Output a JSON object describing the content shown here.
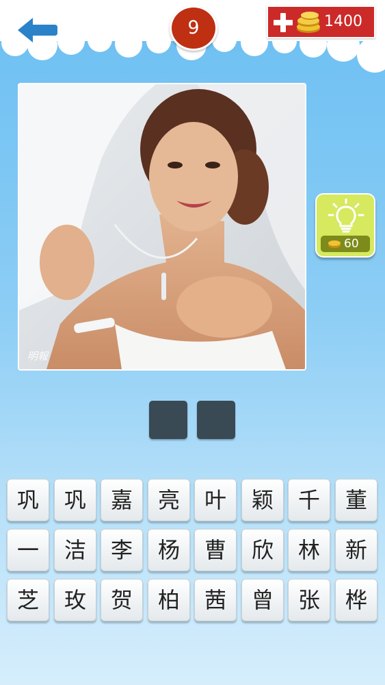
{
  "header": {
    "level": "9",
    "coins": "1400"
  },
  "hint": {
    "cost": "60"
  },
  "answer_slots": [
    "",
    ""
  ],
  "photo": {
    "watermark": "明報"
  },
  "letter_grid": [
    [
      "巩",
      "巩",
      "嘉",
      "亮",
      "叶",
      "颖",
      "千",
      "董"
    ],
    [
      "一",
      "洁",
      "李",
      "杨",
      "曹",
      "欣",
      "林",
      "新"
    ],
    [
      "芝",
      "玫",
      "贺",
      "柏",
      "茜",
      "曾",
      "张",
      "桦"
    ]
  ],
  "colors": {
    "sky_top": "#6bbff2",
    "level_badge": "#bf2f12",
    "coins_button": "#cc2a29",
    "hint_button": "#d6e95f",
    "answer_slot": "#394a55",
    "back_arrow": "#2a82c8"
  },
  "icons": {
    "back": "back-arrow-icon",
    "add": "plus-icon",
    "coins": "coin-stack-icon",
    "hint": "lightbulb-icon"
  }
}
